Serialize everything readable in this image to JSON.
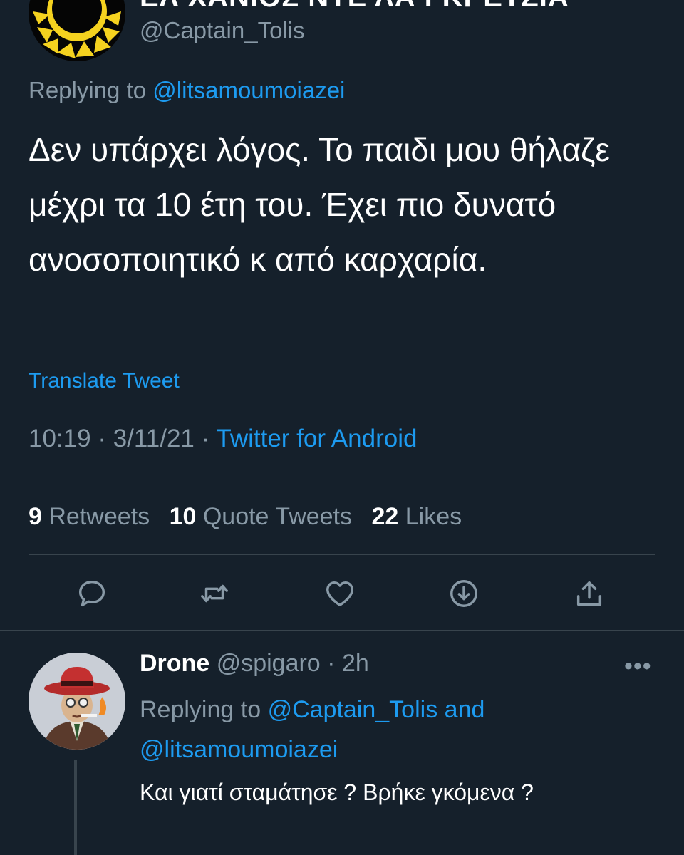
{
  "tweet": {
    "display_name": "ΕΛ ΧΑΝΙΟΣ ΝΤΕ ΛΑ ΓΚΡΕΤΖΙΑ",
    "handle": "@Captain_Tolis",
    "replying_prefix": "Replying to",
    "replying_to": "@litsamoumoiazei",
    "text": "Δεν υπάρχει λόγος. Το παιδι μου θήλαζε μέχρι τα 10 έτη του. Έχει πιο δυνατό ανοσοποιητικό κ από καρχαρία.",
    "translate_label": "Translate Tweet",
    "time": "10:19",
    "date": "3/11/21",
    "separator": " · ",
    "source": "Twitter for Android",
    "stats": {
      "retweets_count": "9",
      "retweets_label": "Retweets",
      "quotes_count": "10",
      "quotes_label": "Quote Tweets",
      "likes_count": "22",
      "likes_label": "Likes"
    },
    "actions": [
      "reply-icon",
      "retweet-icon",
      "like-icon",
      "download-icon",
      "share-icon"
    ]
  },
  "reply": {
    "name": "Drone",
    "handle": "@spigaro",
    "age": "2h",
    "more": "•••",
    "replying_prefix": "Replying to",
    "replying_to_1": "@Captain_Tolis",
    "and": "and",
    "replying_to_2": "@litsamoumoiazei",
    "text": "Και γιατί σταμάτησε ? Βρήκε γκόμενα ?"
  },
  "colors": {
    "background": "#15202b",
    "accent": "#1d9bf0",
    "secondary_text": "#8899a6",
    "divider": "#38444d"
  }
}
